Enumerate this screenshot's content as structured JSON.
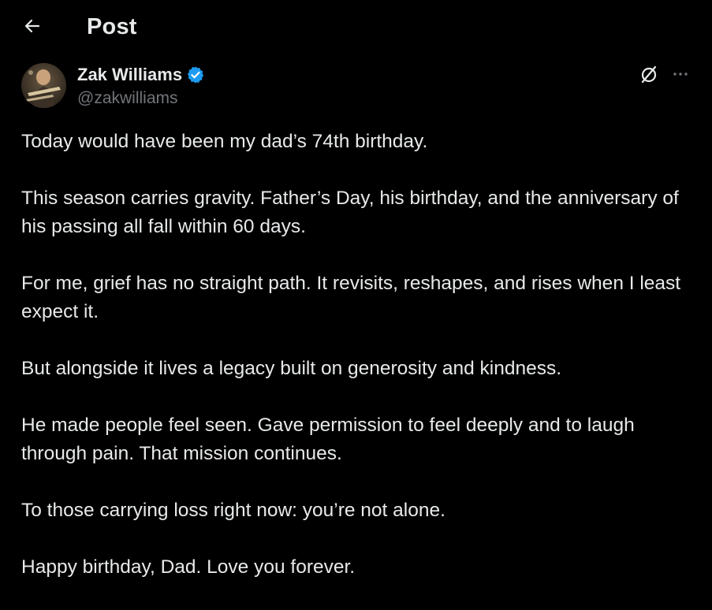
{
  "header": {
    "title": "Post"
  },
  "author": {
    "name": "Zak Williams",
    "handle": "@zakwilliams",
    "verified": true
  },
  "colors": {
    "background": "#000000",
    "text": "#e7e9ea",
    "secondary_text": "#71767b",
    "verified_blue": "#1d9bf0"
  },
  "icons": {
    "back": "arrow-left-icon",
    "verified": "verified-badge-icon",
    "grok": "grok-icon",
    "more": "more-horizontal-icon"
  },
  "post": {
    "paragraphs": [
      "Today would have been my dad’s 74th birthday.",
      "This season carries gravity. Father’s Day, his birthday, and the anniversary of his passing all fall within 60 days.",
      "For me, grief has no straight path. It revisits, reshapes, and rises when I least expect it.",
      "But alongside it lives a legacy built on generosity and kindness.",
      "He made people feel seen. Gave permission to feel deeply and to laugh through pain. That mission continues.",
      "To those carrying loss right now: you’re not alone.",
      "Happy birthday, Dad. Love you forever."
    ]
  }
}
